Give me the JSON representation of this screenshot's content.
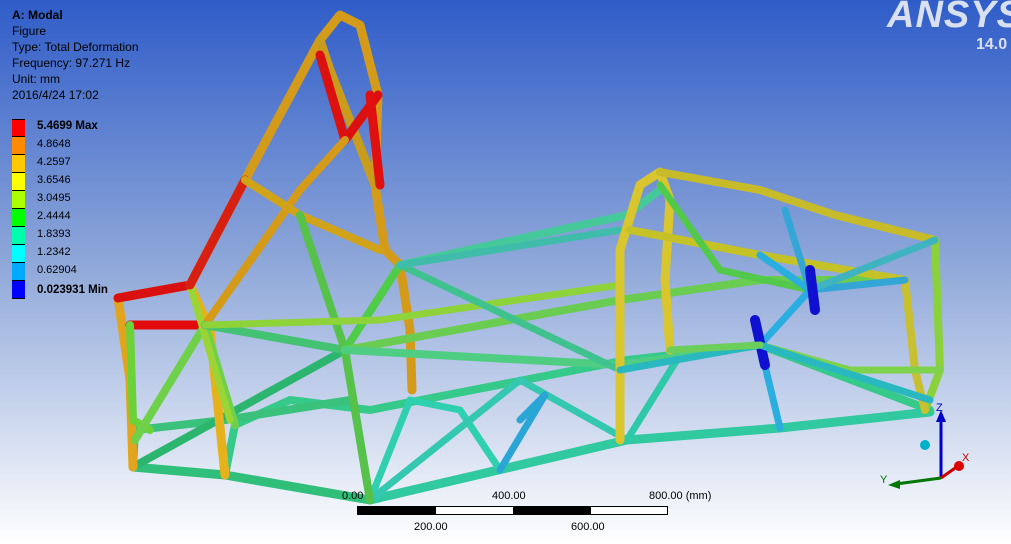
{
  "header": {
    "title": "A: Modal",
    "line1": "Figure",
    "line2": "Type: Total Deformation",
    "line3": "Frequency: 97.271 Hz",
    "line4": "Unit: mm",
    "line5": "2016/4/24 17:02"
  },
  "legend": [
    {
      "label": "5.4699 Max",
      "color": "#ff0000"
    },
    {
      "label": "4.8648",
      "color": "#ff8c00"
    },
    {
      "label": "4.2597",
      "color": "#ffc800"
    },
    {
      "label": "3.6546",
      "color": "#ffff00"
    },
    {
      "label": "3.0495",
      "color": "#aaff00"
    },
    {
      "label": "2.4444",
      "color": "#00ff00"
    },
    {
      "label": "1.8393",
      "color": "#00ffaa"
    },
    {
      "label": "1.2342",
      "color": "#00ffff"
    },
    {
      "label": "0.62904",
      "color": "#00aaff"
    },
    {
      "label": "0.023931 Min",
      "color": "#0000ff"
    }
  ],
  "branding": {
    "logo": "ANSYS",
    "version": "14.0"
  },
  "scale": {
    "top_labels": [
      "0.00",
      "400.00",
      "800.00 (mm)"
    ],
    "bottom_labels": [
      "200.00",
      "600.00"
    ]
  },
  "triad": {
    "z": "Z",
    "x": "X",
    "y": "Y"
  }
}
